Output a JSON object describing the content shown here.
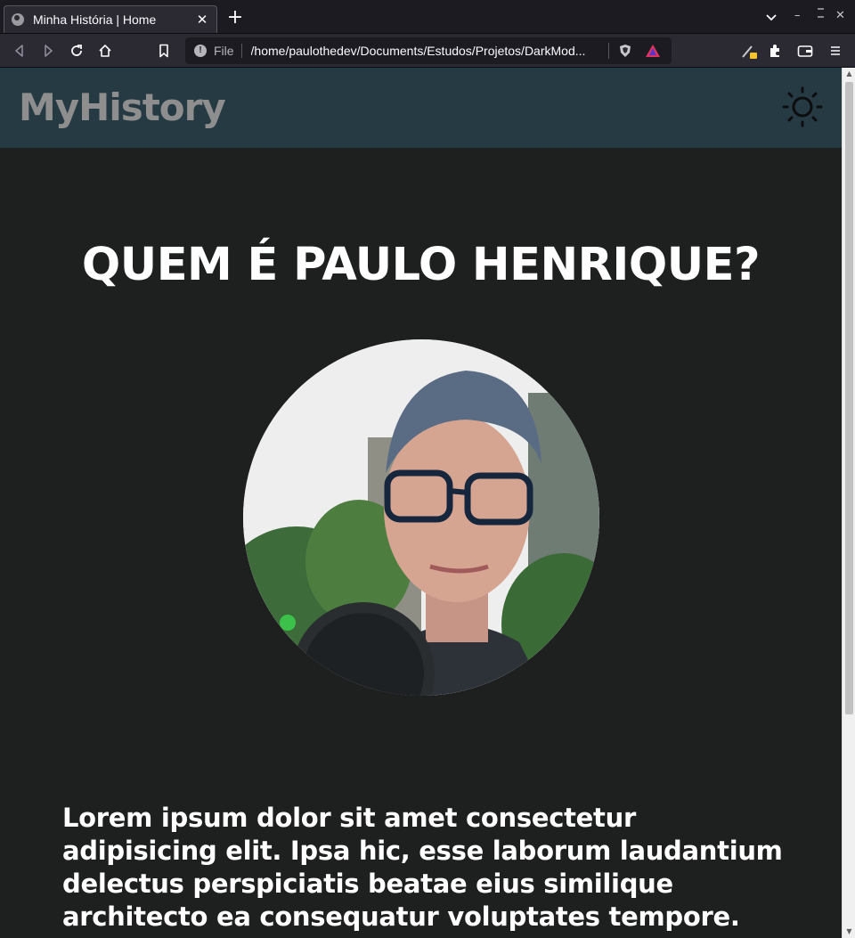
{
  "browser": {
    "tab_title": "Minha História | Home",
    "url_scheme": "File",
    "url": "/home/paulothedev/Documents/Estudos/Projetos/DarkMod..."
  },
  "site": {
    "logo": "MyHistory",
    "theme_toggle_icon": "sun-icon",
    "headline": "QUEM É PAULO HENRIQUE?",
    "avatar_alt": "Paulo Henrique",
    "body": "Lorem ipsum dolor sit amet consectetur adipisicing elit. Ipsa hic, esse laborum laudantium delectus perspiciatis beatae eius similique architecto ea consequatur voluptates tempore. Doloremque quam"
  },
  "colors": {
    "header_bg": "#263a44",
    "page_bg": "#1e1f1f",
    "logo": "#8e8e8e",
    "text": "#ffffff"
  }
}
